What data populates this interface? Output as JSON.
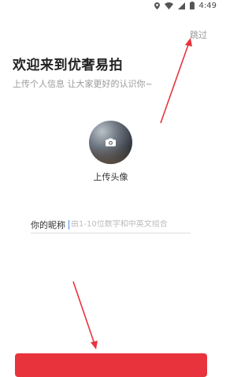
{
  "status_bar": {
    "time": "4:49",
    "icons": [
      "location-icon",
      "wifi-icon",
      "cellular-icon",
      "battery-icon"
    ]
  },
  "header": {
    "skip_label": "跳过",
    "title": "欢迎来到优奢易拍",
    "subtitle": "上传个人信息 让大家更好的认识你~"
  },
  "avatar": {
    "icon": "camera-icon",
    "label": "上传头像"
  },
  "form": {
    "nickname_label": "你的昵称",
    "nickname_value": "",
    "nickname_placeholder": "由1-10位数字和中英文组合"
  },
  "colors": {
    "accent": "#e8333d",
    "annotation_arrow": "#e8333d"
  }
}
